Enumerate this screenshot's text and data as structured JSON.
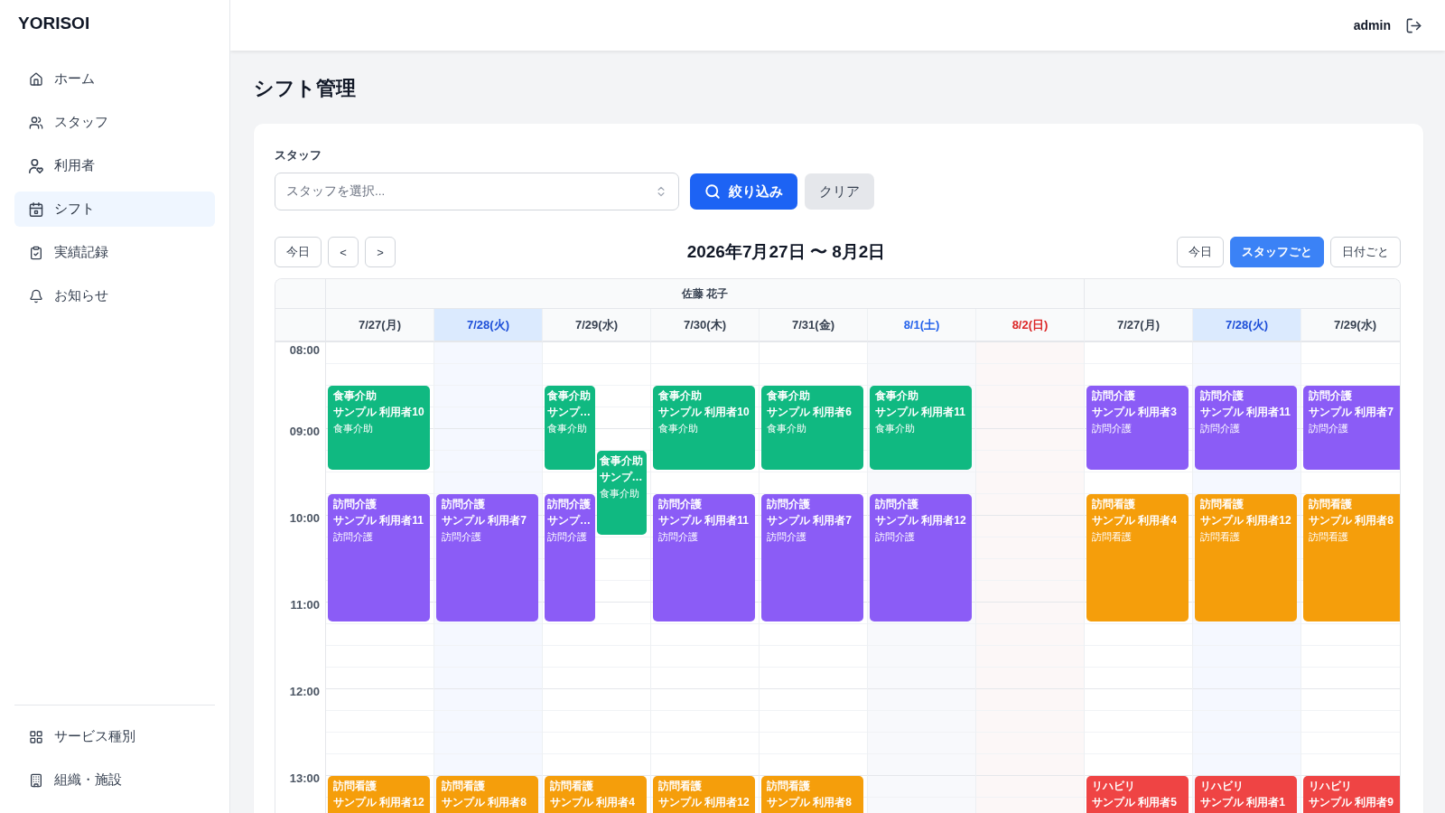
{
  "sidebar": {
    "logo": "YORISOI",
    "items": [
      {
        "label": "ホーム",
        "selected": false
      },
      {
        "label": "スタッフ",
        "selected": false
      },
      {
        "label": "利用者",
        "selected": false
      },
      {
        "label": "シフト",
        "selected": true
      },
      {
        "label": "実績記録",
        "selected": false
      },
      {
        "label": "お知らせ",
        "selected": false
      }
    ],
    "bottom_items": [
      {
        "label": "サービス種別",
        "selected": false
      },
      {
        "label": "組織・施設",
        "selected": false
      }
    ]
  },
  "header": {
    "user": "admin"
  },
  "page_title": "シフト管理",
  "filter": {
    "label": "スタッフ",
    "select": {
      "placeholder": "スタッフを選択..."
    },
    "buttons": [
      {
        "label": "絞り込み",
        "kind": "primary"
      },
      {
        "label": "クリア",
        "kind": "secondary"
      }
    ]
  },
  "calendar_nav": {
    "buttons": [
      "今日",
      "<",
      ">"
    ],
    "range": "2026年7月27日 〜 8月2日",
    "views": [
      {
        "label": "今日",
        "selected": false
      },
      {
        "label": "スタッフごと",
        "selected": true
      },
      {
        "label": "日付ごと",
        "selected": false
      }
    ]
  },
  "calendar": {
    "hours": [
      "08:00",
      "09:00",
      "10:00",
      "11:00",
      "12:00",
      "13:00"
    ],
    "staff": [
      {
        "name": "佐藤 花子",
        "days": [
          {
            "label": "7/27(月)",
            "kind": "weekday",
            "today": false,
            "events": [
              {
                "kind": "early",
                "type": "食事介助",
                "client": "サンプル 利用者10",
                "service": "食事介助",
                "color": "#10b981"
              },
              {
                "kind": "mid",
                "type": "訪問介護",
                "client": "サンプル 利用者11",
                "service": "訪問介護",
                "color": "#8b5cf6"
              },
              {
                "kind": "afternoon",
                "type": "訪問看護",
                "client": "サンプル 利用者12",
                "color": "#f59e0b"
              }
            ]
          },
          {
            "label": "7/28(火)",
            "kind": "weekday",
            "today": true,
            "events": [
              {
                "kind": "mid",
                "type": "訪問介護",
                "client": "サンプル 利用者7",
                "service": "訪問介護",
                "color": "#8b5cf6"
              },
              {
                "kind": "afternoon",
                "type": "訪問看護",
                "client": "サンプル 利用者8",
                "color": "#f59e0b"
              }
            ]
          },
          {
            "label": "7/29(水)",
            "kind": "weekday",
            "today": false,
            "events": [
              {
                "kind": "early",
                "type": "食事介助",
                "client": "サンプ…",
                "service": "食事介助",
                "color": "#10b981"
              },
              {
                "kind": "shifted",
                "type": "食事介助",
                "client": "サンプ…",
                "service": "食事介助",
                "color": "#10b981"
              },
              {
                "kind": "mid",
                "type": "訪問介護",
                "client": "サンプ…",
                "service": "訪問介護",
                "color": "#8b5cf6"
              },
              {
                "kind": "afternoon",
                "type": "訪問看護",
                "client": "サンプル 利用者4",
                "color": "#f59e0b"
              }
            ]
          },
          {
            "label": "7/30(木)",
            "kind": "weekday",
            "today": false,
            "events": [
              {
                "kind": "early",
                "type": "食事介助",
                "client": "サンプル 利用者10",
                "service": "食事介助",
                "color": "#10b981"
              },
              {
                "kind": "mid",
                "type": "訪問介護",
                "client": "サンプル 利用者11",
                "service": "訪問介護",
                "color": "#8b5cf6"
              },
              {
                "kind": "afternoon",
                "type": "訪問看護",
                "client": "サンプル 利用者12",
                "color": "#f59e0b"
              }
            ]
          },
          {
            "label": "7/31(金)",
            "kind": "weekday",
            "today": false,
            "events": [
              {
                "kind": "early",
                "type": "食事介助",
                "client": "サンプル 利用者6",
                "service": "食事介助",
                "color": "#10b981"
              },
              {
                "kind": "mid",
                "type": "訪問介護",
                "client": "サンプル 利用者7",
                "service": "訪問介護",
                "color": "#8b5cf6"
              },
              {
                "kind": "afternoon",
                "type": "訪問看護",
                "client": "サンプル 利用者8",
                "color": "#f59e0b"
              }
            ]
          },
          {
            "label": "8/1(土)",
            "kind": "saturday",
            "today": false,
            "events": [
              {
                "kind": "early",
                "type": "食事介助",
                "client": "サンプル 利用者11",
                "service": "食事介助",
                "color": "#10b981"
              },
              {
                "kind": "mid",
                "type": "訪問介護",
                "client": "サンプル 利用者12",
                "service": "訪問介護",
                "color": "#8b5cf6"
              }
            ]
          },
          {
            "label": "8/2(日)",
            "kind": "sunday",
            "today": false
          }
        ]
      },
      {
        "days": [
          {
            "label": "7/27(月)",
            "kind": "weekday",
            "today": false,
            "events": [
              {
                "kind": "early",
                "type": "訪問介護",
                "client": "サンプル 利用者3",
                "service": "訪問介護",
                "color": "#8b5cf6"
              },
              {
                "kind": "mid",
                "type": "訪問看護",
                "client": "サンプル 利用者4",
                "service": "訪問看護",
                "color": "#f59e0b"
              },
              {
                "kind": "afternoon",
                "type": "リハビリ",
                "client": "サンプル 利用者5",
                "color": "#ef4444"
              }
            ]
          },
          {
            "label": "7/28(火)",
            "kind": "weekday",
            "today": true,
            "events": [
              {
                "kind": "early",
                "type": "訪問介護",
                "client": "サンプル 利用者11",
                "service": "訪問介護",
                "color": "#8b5cf6"
              },
              {
                "kind": "mid",
                "type": "訪問看護",
                "client": "サンプル 利用者12",
                "service": "訪問看護",
                "color": "#f59e0b"
              },
              {
                "kind": "afternoon",
                "type": "リハビリ",
                "client": "サンプル 利用者1",
                "color": "#ef4444"
              }
            ]
          },
          {
            "label": "7/29(水)",
            "kind": "weekday",
            "today": false,
            "events": [
              {
                "kind": "early",
                "type": "訪問介護",
                "client": "サンプル 利用者7",
                "service": "訪問介護",
                "color": "#8b5cf6"
              },
              {
                "kind": "mid",
                "type": "訪問看護",
                "client": "サンプル 利用者8",
                "service": "訪問看護",
                "color": "#f59e0b"
              },
              {
                "kind": "afternoon",
                "type": "リハビリ",
                "client": "サンプル 利用者9",
                "color": "#ef4444"
              }
            ]
          }
        ]
      }
    ]
  }
}
